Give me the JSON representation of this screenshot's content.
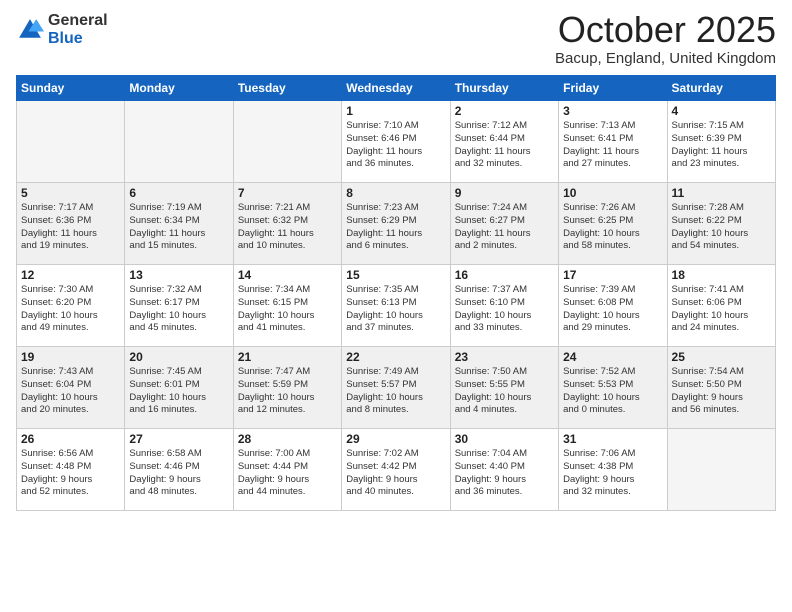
{
  "logo": {
    "general": "General",
    "blue": "Blue"
  },
  "header": {
    "month": "October 2025",
    "location": "Bacup, England, United Kingdom"
  },
  "weekdays": [
    "Sunday",
    "Monday",
    "Tuesday",
    "Wednesday",
    "Thursday",
    "Friday",
    "Saturday"
  ],
  "weeks": [
    [
      {
        "day": "",
        "info": ""
      },
      {
        "day": "",
        "info": ""
      },
      {
        "day": "",
        "info": ""
      },
      {
        "day": "1",
        "info": "Sunrise: 7:10 AM\nSunset: 6:46 PM\nDaylight: 11 hours\nand 36 minutes."
      },
      {
        "day": "2",
        "info": "Sunrise: 7:12 AM\nSunset: 6:44 PM\nDaylight: 11 hours\nand 32 minutes."
      },
      {
        "day": "3",
        "info": "Sunrise: 7:13 AM\nSunset: 6:41 PM\nDaylight: 11 hours\nand 27 minutes."
      },
      {
        "day": "4",
        "info": "Sunrise: 7:15 AM\nSunset: 6:39 PM\nDaylight: 11 hours\nand 23 minutes."
      }
    ],
    [
      {
        "day": "5",
        "info": "Sunrise: 7:17 AM\nSunset: 6:36 PM\nDaylight: 11 hours\nand 19 minutes."
      },
      {
        "day": "6",
        "info": "Sunrise: 7:19 AM\nSunset: 6:34 PM\nDaylight: 11 hours\nand 15 minutes."
      },
      {
        "day": "7",
        "info": "Sunrise: 7:21 AM\nSunset: 6:32 PM\nDaylight: 11 hours\nand 10 minutes."
      },
      {
        "day": "8",
        "info": "Sunrise: 7:23 AM\nSunset: 6:29 PM\nDaylight: 11 hours\nand 6 minutes."
      },
      {
        "day": "9",
        "info": "Sunrise: 7:24 AM\nSunset: 6:27 PM\nDaylight: 11 hours\nand 2 minutes."
      },
      {
        "day": "10",
        "info": "Sunrise: 7:26 AM\nSunset: 6:25 PM\nDaylight: 10 hours\nand 58 minutes."
      },
      {
        "day": "11",
        "info": "Sunrise: 7:28 AM\nSunset: 6:22 PM\nDaylight: 10 hours\nand 54 minutes."
      }
    ],
    [
      {
        "day": "12",
        "info": "Sunrise: 7:30 AM\nSunset: 6:20 PM\nDaylight: 10 hours\nand 49 minutes."
      },
      {
        "day": "13",
        "info": "Sunrise: 7:32 AM\nSunset: 6:17 PM\nDaylight: 10 hours\nand 45 minutes."
      },
      {
        "day": "14",
        "info": "Sunrise: 7:34 AM\nSunset: 6:15 PM\nDaylight: 10 hours\nand 41 minutes."
      },
      {
        "day": "15",
        "info": "Sunrise: 7:35 AM\nSunset: 6:13 PM\nDaylight: 10 hours\nand 37 minutes."
      },
      {
        "day": "16",
        "info": "Sunrise: 7:37 AM\nSunset: 6:10 PM\nDaylight: 10 hours\nand 33 minutes."
      },
      {
        "day": "17",
        "info": "Sunrise: 7:39 AM\nSunset: 6:08 PM\nDaylight: 10 hours\nand 29 minutes."
      },
      {
        "day": "18",
        "info": "Sunrise: 7:41 AM\nSunset: 6:06 PM\nDaylight: 10 hours\nand 24 minutes."
      }
    ],
    [
      {
        "day": "19",
        "info": "Sunrise: 7:43 AM\nSunset: 6:04 PM\nDaylight: 10 hours\nand 20 minutes."
      },
      {
        "day": "20",
        "info": "Sunrise: 7:45 AM\nSunset: 6:01 PM\nDaylight: 10 hours\nand 16 minutes."
      },
      {
        "day": "21",
        "info": "Sunrise: 7:47 AM\nSunset: 5:59 PM\nDaylight: 10 hours\nand 12 minutes."
      },
      {
        "day": "22",
        "info": "Sunrise: 7:49 AM\nSunset: 5:57 PM\nDaylight: 10 hours\nand 8 minutes."
      },
      {
        "day": "23",
        "info": "Sunrise: 7:50 AM\nSunset: 5:55 PM\nDaylight: 10 hours\nand 4 minutes."
      },
      {
        "day": "24",
        "info": "Sunrise: 7:52 AM\nSunset: 5:53 PM\nDaylight: 10 hours\nand 0 minutes."
      },
      {
        "day": "25",
        "info": "Sunrise: 7:54 AM\nSunset: 5:50 PM\nDaylight: 9 hours\nand 56 minutes."
      }
    ],
    [
      {
        "day": "26",
        "info": "Sunrise: 6:56 AM\nSunset: 4:48 PM\nDaylight: 9 hours\nand 52 minutes."
      },
      {
        "day": "27",
        "info": "Sunrise: 6:58 AM\nSunset: 4:46 PM\nDaylight: 9 hours\nand 48 minutes."
      },
      {
        "day": "28",
        "info": "Sunrise: 7:00 AM\nSunset: 4:44 PM\nDaylight: 9 hours\nand 44 minutes."
      },
      {
        "day": "29",
        "info": "Sunrise: 7:02 AM\nSunset: 4:42 PM\nDaylight: 9 hours\nand 40 minutes."
      },
      {
        "day": "30",
        "info": "Sunrise: 7:04 AM\nSunset: 4:40 PM\nDaylight: 9 hours\nand 36 minutes."
      },
      {
        "day": "31",
        "info": "Sunrise: 7:06 AM\nSunset: 4:38 PM\nDaylight: 9 hours\nand 32 minutes."
      },
      {
        "day": "",
        "info": ""
      }
    ]
  ]
}
